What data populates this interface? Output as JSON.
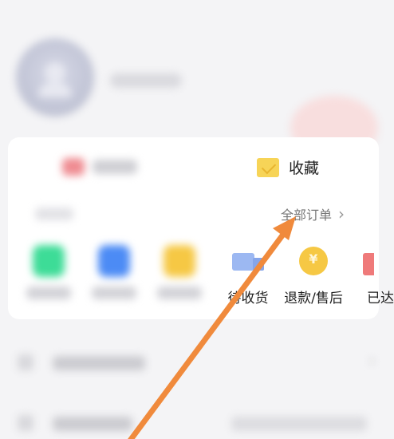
{
  "profile": {
    "avatar_icon": "user-avatar-icon"
  },
  "quick_actions": {
    "collect_label": "收藏",
    "collect_icon": "bookmark-icon"
  },
  "orders": {
    "all_orders_label": "全部订单",
    "chevron": "›",
    "items": [
      {
        "icon": "pending-payment-icon",
        "color": "#3ddc97"
      },
      {
        "icon": "pending-ship-icon",
        "color": "#4c8bf5"
      },
      {
        "icon": "pending-review-icon",
        "color": "#f6c844"
      },
      {
        "icon": "truck-icon",
        "label": "待收货"
      },
      {
        "icon": "refund-icon",
        "label": "退款/售后",
        "symbol": "¥"
      },
      {
        "icon": "completed-icon",
        "label": "已达"
      }
    ]
  },
  "annotation": {
    "arrow_color": "#f08a3c"
  }
}
